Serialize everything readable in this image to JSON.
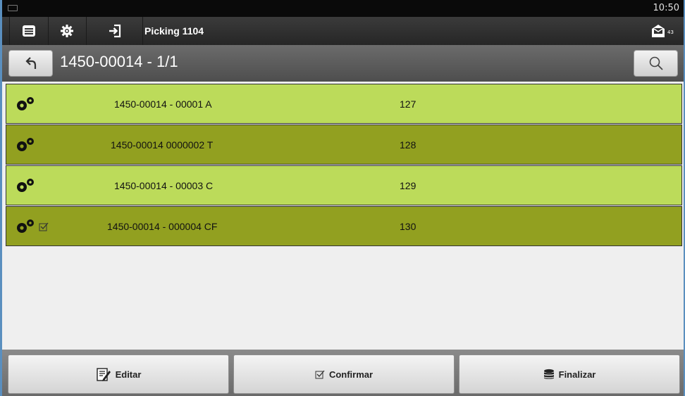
{
  "statusbar": {
    "time": "10:50"
  },
  "actionbar": {
    "title": "Picking 1104",
    "mail_badge": "43"
  },
  "header": {
    "title": "1450-00014 - 1/1"
  },
  "rows": [
    {
      "code": "1450-00014 - 00001 A",
      "number": "127",
      "checked": false
    },
    {
      "code": "1450-00014 0000002 T",
      "number": "128",
      "checked": false
    },
    {
      "code": "1450-00014 - 00003 C",
      "number": "129",
      "checked": false
    },
    {
      "code": "1450-00014 - 000004 CF",
      "number": "130",
      "checked": true
    }
  ],
  "footer": {
    "edit_label": "Editar",
    "confirm_label": "Confirmar",
    "finish_label": "Finalizar"
  },
  "colors": {
    "row_light": "#bcdb5a",
    "row_dark": "#92a020",
    "actionbar": "#2e2e2e"
  }
}
